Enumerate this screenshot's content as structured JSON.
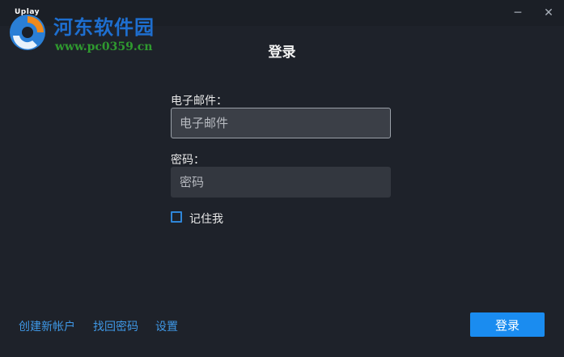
{
  "window": {
    "minimize_glyph": "─",
    "close_glyph": "✕"
  },
  "watermark": {
    "logo_text": "Uplay",
    "site_name": "河东软件园",
    "url": "www.pc0359.cn"
  },
  "dialog": {
    "title": "登录"
  },
  "form": {
    "email_label": "电子邮件：",
    "email_placeholder": "电子邮件",
    "email_value": "",
    "password_label": "密码：",
    "password_placeholder": "密码",
    "password_value": "",
    "remember_label": "记住我",
    "remember_checked": false
  },
  "footer": {
    "create_account": "创建新帐户",
    "recover_password": "找回密码",
    "settings": "设置",
    "login_button": "登录"
  },
  "colors": {
    "background": "#1e222a",
    "accent": "#1a8cf0",
    "link": "#3f98e6"
  }
}
